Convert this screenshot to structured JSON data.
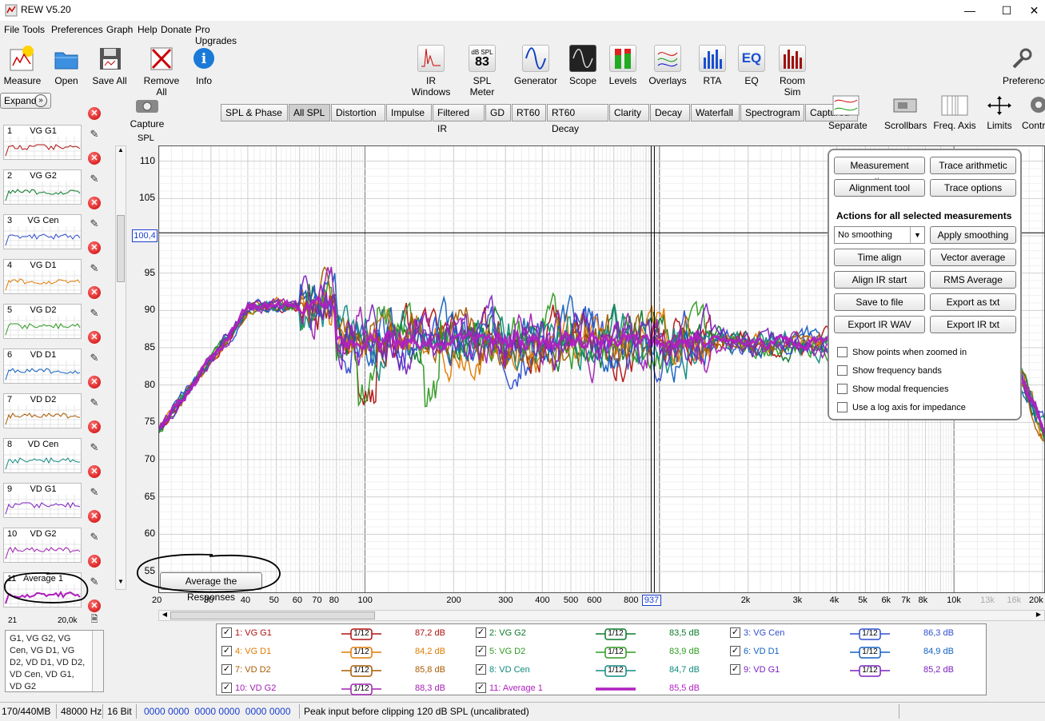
{
  "window": {
    "title": "REW V5.20"
  },
  "menu": [
    "File",
    "Tools",
    "Preferences",
    "Graph",
    "Help",
    "Donate",
    "Pro Upgrades"
  ],
  "toolbar_left": [
    {
      "label": "Measure",
      "icon": "measure-icon"
    },
    {
      "label": "Open",
      "icon": "folder-icon"
    },
    {
      "label": "Save All",
      "icon": "save-icon"
    },
    {
      "label": "Remove All",
      "icon": "remove-icon"
    },
    {
      "label": "Info",
      "icon": "info-icon"
    }
  ],
  "toolbar_mid": [
    {
      "label": "IR Windows"
    },
    {
      "label": "SPL Meter",
      "badge_top": "dB SPL",
      "badge_val": "83"
    },
    {
      "label": "Generator"
    },
    {
      "label": "Scope"
    },
    {
      "label": "Levels"
    },
    {
      "label": "Overlays"
    },
    {
      "label": "RTA"
    },
    {
      "label": "EQ",
      "badge_val": "EQ"
    },
    {
      "label": "Room Sim"
    }
  ],
  "toolbar_right": {
    "preferences": "Preferences"
  },
  "leftpanel": {
    "expand_label": "Expand",
    "measurements": [
      {
        "num": "1",
        "name": "VG G1",
        "color": "#b01010"
      },
      {
        "num": "2",
        "name": "VG G2",
        "color": "#0a7a2a"
      },
      {
        "num": "3",
        "name": "VG Cen",
        "color": "#2f4fd0"
      },
      {
        "num": "4",
        "name": "VG D1",
        "color": "#e07a00"
      },
      {
        "num": "5",
        "name": "VG D2",
        "color": "#2e9a20"
      },
      {
        "num": "6",
        "name": "VD D1",
        "color": "#1060c0"
      },
      {
        "num": "7",
        "name": "VD D2",
        "color": "#a85a00"
      },
      {
        "num": "8",
        "name": "VD Cen",
        "color": "#108a80"
      },
      {
        "num": "9",
        "name": "VD G1",
        "color": "#7a20c0"
      },
      {
        "num": "10",
        "name": "VD G2",
        "color": "#a020b0"
      },
      {
        "num": "11",
        "name": "Average 1",
        "color": "#b020c0"
      }
    ],
    "range_lo": "21",
    "range_hi": "20,0k",
    "names_text": "G1, VG G2, VG Cen, VG D1, VG D2, VD D1, VD D2, VD Cen, VD G1, VD G2"
  },
  "capture": {
    "label": "Capture"
  },
  "tabs": [
    "SPL & Phase",
    "All SPL",
    "Distortion",
    "Impulse",
    "Filtered IR",
    "GD",
    "RT60",
    "RT60 Decay",
    "Clarity",
    "Decay",
    "Waterfall",
    "Spectrogram",
    "Captured"
  ],
  "selected_tab": "All SPL",
  "graph_tools": [
    "Separate",
    "Scrollbars",
    "Freq. Axis",
    "Limits",
    "Controls"
  ],
  "graph_tools_visible": [
    "Separate",
    "Scrollbars",
    "Freq. Axis",
    "Limits",
    "Contro"
  ],
  "graph": {
    "yaxis_label": "SPL",
    "yticks": [
      "110",
      "105",
      "95",
      "90",
      "85",
      "80",
      "75",
      "70",
      "65",
      "60",
      "55"
    ],
    "cursor_y": "100,4",
    "cursor_x": "937",
    "xticks": [
      "20",
      "30",
      "40",
      "50",
      "60",
      "70",
      "80",
      "100",
      "200",
      "300",
      "400",
      "500",
      "600",
      "800",
      "1k",
      "2k",
      "3k",
      "4k",
      "5k",
      "6k",
      "7k",
      "8k",
      "10k",
      "13k",
      "16k",
      "20k"
    ],
    "average_button": "Average the Responses"
  },
  "action_panel": {
    "buttons": [
      "Measurement actions",
      "Trace arithmetic",
      "Alignment tool",
      "Trace options"
    ],
    "section_title": "Actions for all selected measurements",
    "smoothing_value": "No  smoothing",
    "apply_smoothing": "Apply smoothing",
    "actions": [
      "Time align",
      "Vector average",
      "Align IR start",
      "RMS Average",
      "Save to file",
      "Export as txt",
      "Export IR WAV",
      "Export IR txt"
    ],
    "checks": [
      "Show points when zoomed in",
      "Show frequency bands",
      "Show modal frequencies",
      "Use a log axis for impedance"
    ]
  },
  "legend": [
    {
      "label": "1: VG G1",
      "smooth": "1/12",
      "value": "87,2 dB",
      "color": "#b01010"
    },
    {
      "label": "2: VG G2",
      "smooth": "1/12",
      "value": "83,5 dB",
      "color": "#0a7a2a"
    },
    {
      "label": "3: VG Cen",
      "smooth": "1/12",
      "value": "86,3 dB",
      "color": "#2f4fd0"
    },
    {
      "label": "4: VG D1",
      "smooth": "1/12",
      "value": "84,2 dB",
      "color": "#e07a00"
    },
    {
      "label": "5: VG D2",
      "smooth": "1/12",
      "value": "83,9 dB",
      "color": "#2e9a20"
    },
    {
      "label": "6: VD D1",
      "smooth": "1/12",
      "value": "84,9 dB",
      "color": "#1060c0"
    },
    {
      "label": "7: VD D2",
      "smooth": "1/12",
      "value": "85,8 dB",
      "color": "#a85a00"
    },
    {
      "label": "8: VD Cen",
      "smooth": "1/12",
      "value": "84,7 dB",
      "color": "#108a80"
    },
    {
      "label": "9: VD G1",
      "smooth": "1/12",
      "value": "85,2 dB",
      "color": "#7a20c0"
    },
    {
      "label": "10: VD G2",
      "smooth": "1/12",
      "value": "88,3 dB",
      "color": "#a020b0"
    },
    {
      "label": "11: Average 1",
      "smooth": "",
      "value": "85,5 dB",
      "color": "#b020c0"
    }
  ],
  "status": {
    "memory": "170/440MB",
    "rate": "48000 Hz",
    "bits": "16 Bit",
    "levels": "0000 0000  0000 0000  0000 0000",
    "message": "Peak input before clipping 120 dB SPL (uncalibrated)"
  }
}
